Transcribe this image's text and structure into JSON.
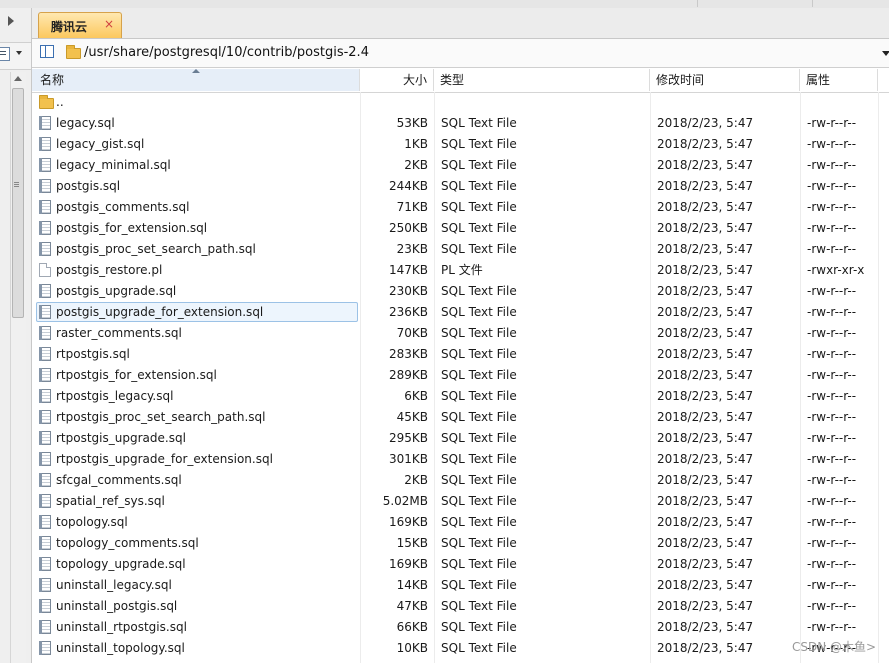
{
  "tab": {
    "label": "腾讯云",
    "close": "×"
  },
  "path": {
    "value": "/usr/share/postgresql/10/contrib/postgis-2.4"
  },
  "columns": {
    "name": "名称",
    "size": "大小",
    "type": "类型",
    "modified": "修改时间",
    "attributes": "属性"
  },
  "files": [
    {
      "name": "..",
      "size": "",
      "type": "",
      "modified": "",
      "attr": "",
      "icon": "folder-icon"
    },
    {
      "name": "legacy.sql",
      "size": "53KB",
      "type": "SQL Text File",
      "modified": "2018/2/23, 5:47",
      "attr": "-rw-r--r--",
      "icon": "sql-file-icon"
    },
    {
      "name": "legacy_gist.sql",
      "size": "1KB",
      "type": "SQL Text File",
      "modified": "2018/2/23, 5:47",
      "attr": "-rw-r--r--",
      "icon": "sql-file-icon"
    },
    {
      "name": "legacy_minimal.sql",
      "size": "2KB",
      "type": "SQL Text File",
      "modified": "2018/2/23, 5:47",
      "attr": "-rw-r--r--",
      "icon": "sql-file-icon"
    },
    {
      "name": "postgis.sql",
      "size": "244KB",
      "type": "SQL Text File",
      "modified": "2018/2/23, 5:47",
      "attr": "-rw-r--r--",
      "icon": "sql-file-icon"
    },
    {
      "name": "postgis_comments.sql",
      "size": "71KB",
      "type": "SQL Text File",
      "modified": "2018/2/23, 5:47",
      "attr": "-rw-r--r--",
      "icon": "sql-file-icon"
    },
    {
      "name": "postgis_for_extension.sql",
      "size": "250KB",
      "type": "SQL Text File",
      "modified": "2018/2/23, 5:47",
      "attr": "-rw-r--r--",
      "icon": "sql-file-icon"
    },
    {
      "name": "postgis_proc_set_search_path.sql",
      "size": "23KB",
      "type": "SQL Text File",
      "modified": "2018/2/23, 5:47",
      "attr": "-rw-r--r--",
      "icon": "sql-file-icon"
    },
    {
      "name": "postgis_restore.pl",
      "size": "147KB",
      "type": "PL 文件",
      "modified": "2018/2/23, 5:47",
      "attr": "-rwxr-xr-x",
      "icon": "pl-file-icon"
    },
    {
      "name": "postgis_upgrade.sql",
      "size": "230KB",
      "type": "SQL Text File",
      "modified": "2018/2/23, 5:47",
      "attr": "-rw-r--r--",
      "icon": "sql-file-icon"
    },
    {
      "name": "postgis_upgrade_for_extension.sql",
      "size": "236KB",
      "type": "SQL Text File",
      "modified": "2018/2/23, 5:47",
      "attr": "-rw-r--r--",
      "icon": "sql-file-icon",
      "selected": true
    },
    {
      "name": "raster_comments.sql",
      "size": "70KB",
      "type": "SQL Text File",
      "modified": "2018/2/23, 5:47",
      "attr": "-rw-r--r--",
      "icon": "sql-file-icon"
    },
    {
      "name": "rtpostgis.sql",
      "size": "283KB",
      "type": "SQL Text File",
      "modified": "2018/2/23, 5:47",
      "attr": "-rw-r--r--",
      "icon": "sql-file-icon"
    },
    {
      "name": "rtpostgis_for_extension.sql",
      "size": "289KB",
      "type": "SQL Text File",
      "modified": "2018/2/23, 5:47",
      "attr": "-rw-r--r--",
      "icon": "sql-file-icon"
    },
    {
      "name": "rtpostgis_legacy.sql",
      "size": "6KB",
      "type": "SQL Text File",
      "modified": "2018/2/23, 5:47",
      "attr": "-rw-r--r--",
      "icon": "sql-file-icon"
    },
    {
      "name": "rtpostgis_proc_set_search_path.sql",
      "size": "45KB",
      "type": "SQL Text File",
      "modified": "2018/2/23, 5:47",
      "attr": "-rw-r--r--",
      "icon": "sql-file-icon"
    },
    {
      "name": "rtpostgis_upgrade.sql",
      "size": "295KB",
      "type": "SQL Text File",
      "modified": "2018/2/23, 5:47",
      "attr": "-rw-r--r--",
      "icon": "sql-file-icon"
    },
    {
      "name": "rtpostgis_upgrade_for_extension.sql",
      "size": "301KB",
      "type": "SQL Text File",
      "modified": "2018/2/23, 5:47",
      "attr": "-rw-r--r--",
      "icon": "sql-file-icon"
    },
    {
      "name": "sfcgal_comments.sql",
      "size": "2KB",
      "type": "SQL Text File",
      "modified": "2018/2/23, 5:47",
      "attr": "-rw-r--r--",
      "icon": "sql-file-icon"
    },
    {
      "name": "spatial_ref_sys.sql",
      "size": "5.02MB",
      "type": "SQL Text File",
      "modified": "2018/2/23, 5:47",
      "attr": "-rw-r--r--",
      "icon": "sql-file-icon"
    },
    {
      "name": "topology.sql",
      "size": "169KB",
      "type": "SQL Text File",
      "modified": "2018/2/23, 5:47",
      "attr": "-rw-r--r--",
      "icon": "sql-file-icon"
    },
    {
      "name": "topology_comments.sql",
      "size": "15KB",
      "type": "SQL Text File",
      "modified": "2018/2/23, 5:47",
      "attr": "-rw-r--r--",
      "icon": "sql-file-icon"
    },
    {
      "name": "topology_upgrade.sql",
      "size": "169KB",
      "type": "SQL Text File",
      "modified": "2018/2/23, 5:47",
      "attr": "-rw-r--r--",
      "icon": "sql-file-icon"
    },
    {
      "name": "uninstall_legacy.sql",
      "size": "14KB",
      "type": "SQL Text File",
      "modified": "2018/2/23, 5:47",
      "attr": "-rw-r--r--",
      "icon": "sql-file-icon"
    },
    {
      "name": "uninstall_postgis.sql",
      "size": "47KB",
      "type": "SQL Text File",
      "modified": "2018/2/23, 5:47",
      "attr": "-rw-r--r--",
      "icon": "sql-file-icon"
    },
    {
      "name": "uninstall_rtpostgis.sql",
      "size": "66KB",
      "type": "SQL Text File",
      "modified": "2018/2/23, 5:47",
      "attr": "-rw-r--r--",
      "icon": "sql-file-icon"
    },
    {
      "name": "uninstall_topology.sql",
      "size": "10KB",
      "type": "SQL Text File",
      "modified": "2018/2/23, 5:47",
      "attr": "-rw-r--r--",
      "icon": "sql-file-icon"
    }
  ],
  "watermark": "CSDN @木鱼>",
  "colors": {
    "tab_active": "#fcc85e",
    "selection": "#9cc2e6",
    "header_sorted": "#e6eef8"
  }
}
